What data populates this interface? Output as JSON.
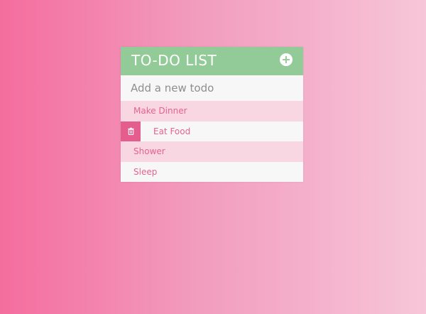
{
  "app": {
    "title": "TO-DO LIST",
    "add_icon": "plus-circle-icon"
  },
  "new_todo": {
    "placeholder": "Add a new todo",
    "value": ""
  },
  "todos": [
    {
      "label": "Make Dinner"
    },
    {
      "label": "Eat Food",
      "show_delete": true,
      "delete_icon": "trash-icon"
    },
    {
      "label": "Shower"
    },
    {
      "label": "Sleep"
    }
  ],
  "colors": {
    "header": "#92cb97",
    "accent": "#e45d8d",
    "row_alt": "#f8d7e3",
    "row": "#f7f7f7"
  }
}
